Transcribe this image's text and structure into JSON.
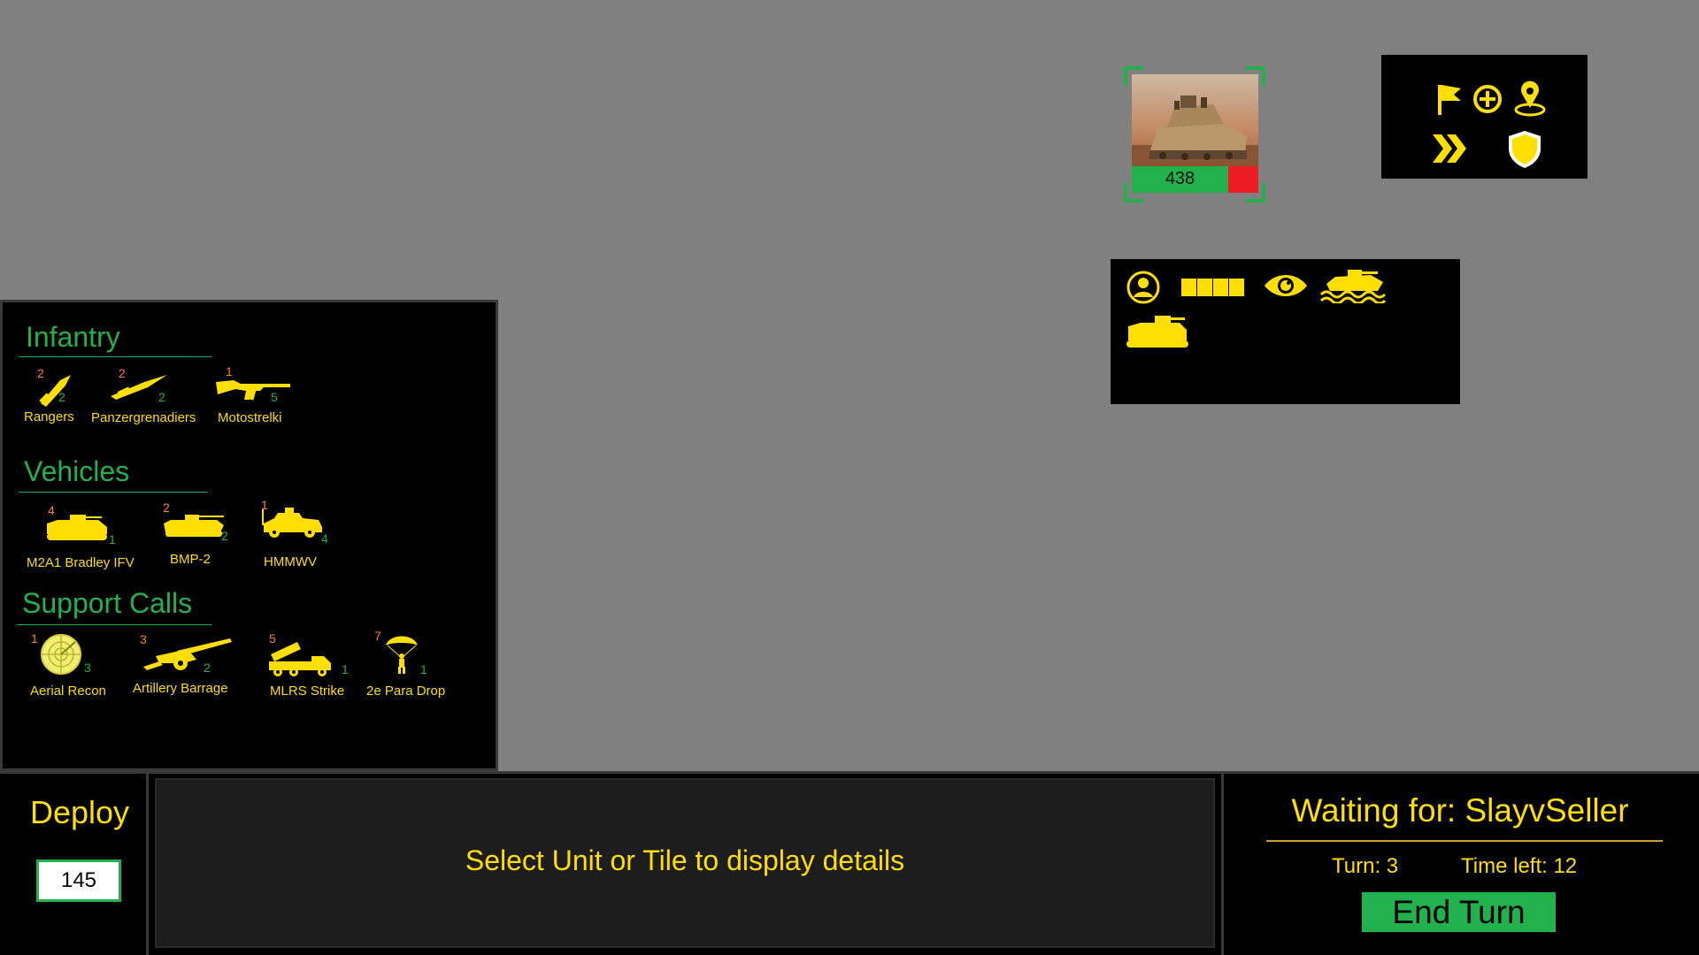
{
  "unit_card": {
    "hp_value": "438",
    "hp_fraction": 0.76,
    "photo_icon": "bradley-ifv-photo"
  },
  "orders": {
    "icons": [
      "flag-icon",
      "plus-circle-icon",
      "map-pin-icon",
      "double-chevron-icon",
      "shield-icon"
    ]
  },
  "traits": {
    "icons": [
      "commander-icon",
      "armor-bar-icon",
      "eye-icon",
      "amphibious-icon",
      "tracked-vehicle-icon"
    ]
  },
  "deck": {
    "sections": [
      {
        "title": "Infantry",
        "cards": [
          {
            "name": "Rangers",
            "cost": "2",
            "count": "2",
            "icon": "knife-icon"
          },
          {
            "name": "Panzergrenadiers",
            "cost": "2",
            "count": "2",
            "icon": "bayonet-icon"
          },
          {
            "name": "Motostrelki",
            "cost": "1",
            "count": "5",
            "icon": "rifle-icon"
          }
        ]
      },
      {
        "title": "Vehicles",
        "cards": [
          {
            "name": "M2A1 Bradley IFV",
            "cost": "4",
            "count": "1",
            "icon": "ifv-icon"
          },
          {
            "name": "BMP-2",
            "cost": "2",
            "count": "2",
            "icon": "bmp-icon"
          },
          {
            "name": "HMMWV",
            "cost": "1",
            "count": "4",
            "icon": "humvee-icon"
          }
        ]
      },
      {
        "title": "Support Calls",
        "cards": [
          {
            "name": "Aerial Recon",
            "cost": "1",
            "count": "3",
            "icon": "radar-icon"
          },
          {
            "name": "Artillery Barrage",
            "cost": "3",
            "count": "2",
            "icon": "howitzer-icon"
          },
          {
            "name": "MLRS Strike",
            "cost": "5",
            "count": "1",
            "icon": "rocket-launcher-icon"
          },
          {
            "name": "2e Para Drop",
            "cost": "7",
            "count": "1",
            "icon": "paratrooper-icon"
          }
        ]
      }
    ]
  },
  "deploy": {
    "label": "Deploy",
    "points": "145"
  },
  "details": {
    "message": "Select Unit or Tile to display details"
  },
  "turn": {
    "waiting": "Waiting for: SlayvSeller",
    "turn_label": "Turn: 3",
    "time_label": "Time left: 12",
    "end_turn_label": "End Turn"
  },
  "colors": {
    "background": "#808080",
    "accent_green": "#22b14c",
    "text_yellow": "#ffde00",
    "cost_orange": "#ff7f27",
    "damage_red": "#ed1c24"
  }
}
